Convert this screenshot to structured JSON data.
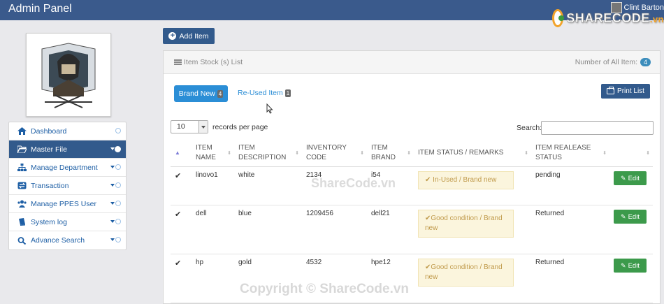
{
  "app": {
    "title": "Admin Panel"
  },
  "user": {
    "name": "Clint Barton"
  },
  "watermark": {
    "brand": "SHARECODE",
    "domain": ".vn",
    "center": "ShareCode.vn",
    "copyright": "Copyright © ShareCode.vn"
  },
  "sidebar": {
    "items": [
      {
        "label": "Dashboard",
        "icon": "home-icon",
        "active": false,
        "caret": false
      },
      {
        "label": "Master File",
        "icon": "folder-open-icon",
        "active": true,
        "caret": true
      },
      {
        "label": "Manage Department",
        "icon": "sitemap-icon",
        "active": false,
        "caret": true
      },
      {
        "label": "Transaction",
        "icon": "exchange-icon",
        "active": false,
        "caret": true
      },
      {
        "label": "Manage PPES User",
        "icon": "users-icon",
        "active": false,
        "caret": true
      },
      {
        "label": "System log",
        "icon": "book-icon",
        "active": false,
        "caret": true
      },
      {
        "label": "Advance Search",
        "icon": "search-icon",
        "active": false,
        "caret": true
      }
    ]
  },
  "toolbar": {
    "add_label": "Add Item"
  },
  "panel": {
    "title": "Item Stock (s) List",
    "count_label": "Number of All Item:",
    "count": "4"
  },
  "tabs": [
    {
      "label": "Brand New",
      "count": "4"
    },
    {
      "label": "Re-Used Item",
      "count": "1"
    }
  ],
  "print_label": "Print List",
  "length": {
    "value": "10",
    "label": "records per page"
  },
  "search": {
    "label": "Search:",
    "value": ""
  },
  "table": {
    "headers": [
      "ITEM NAME",
      "ITEM DESCRIPTION",
      "INVENTORY CODE",
      "ITEM BRAND",
      "ITEM STATUS / REMARKS",
      "ITEM REALEASE STATUS"
    ],
    "rows": [
      {
        "name": "linovo1",
        "desc": "white",
        "code": "2134",
        "brand": "i54",
        "status": "In-Used / Brand new",
        "release": "pending",
        "action": "Edit"
      },
      {
        "name": "dell",
        "desc": "blue",
        "code": "1209456",
        "brand": "dell21",
        "status": "Good condition / Brand new",
        "release": "Returned",
        "action": "Edit"
      },
      {
        "name": "hp",
        "desc": "gold",
        "code": "4532",
        "brand": "hpe12",
        "status": "Good condition / Brand new",
        "release": "Returned",
        "action": "Edit"
      }
    ]
  },
  "colors": {
    "topbar": "#3a5a8c",
    "accent": "#2b8ed6",
    "success": "#3c9a4b",
    "warning_bg": "#fbf5dd"
  }
}
